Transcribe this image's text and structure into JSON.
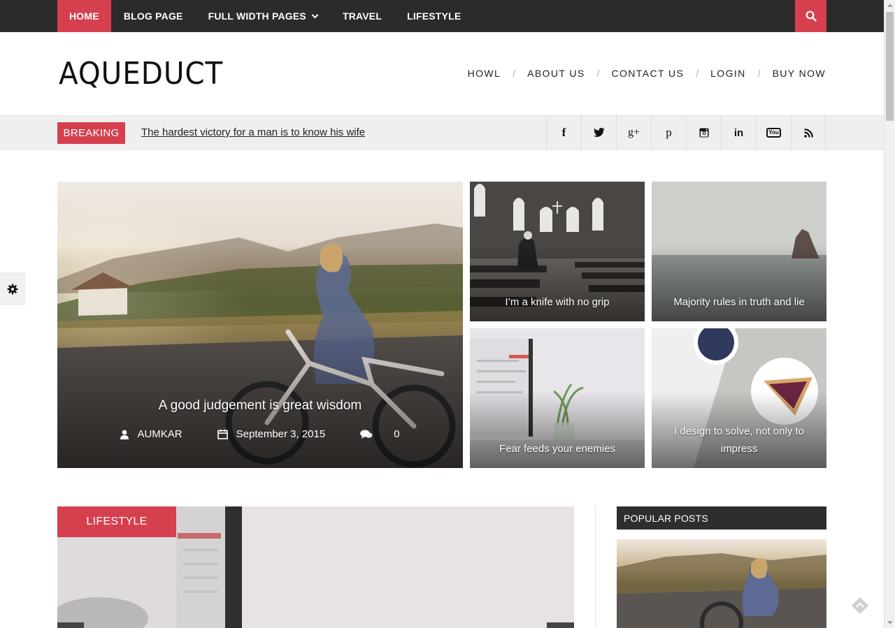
{
  "topnav": {
    "items": [
      {
        "label": "HOME"
      },
      {
        "label": "BLOG PAGE"
      },
      {
        "label": "FULL WIDTH PAGES"
      },
      {
        "label": "TRAVEL"
      },
      {
        "label": "LIFESTYLE"
      }
    ],
    "active_index": 0
  },
  "header": {
    "logo": "AQUEDUCT",
    "nav": [
      {
        "label": "HOWL"
      },
      {
        "label": "ABOUT US"
      },
      {
        "label": "CONTACT US"
      },
      {
        "label": "LOGIN"
      },
      {
        "label": "BUY NOW"
      }
    ],
    "separator": "/"
  },
  "breaking": {
    "label": "BREAKING",
    "headline": "The hardest victory for a man is to know his wife"
  },
  "socials": {
    "icons": [
      "facebook-icon",
      "twitter-icon",
      "google-plus-icon",
      "pinterest-icon",
      "instagram-icon",
      "linkedin-icon",
      "youtube-icon",
      "rss-icon"
    ],
    "glyphs": {
      "facebook": "f",
      "google_plus": "g+",
      "pinterest": "p",
      "linkedin": "in",
      "youtube": "You"
    }
  },
  "featured": {
    "main": {
      "title": "A good judgement is great wisdom",
      "author": "AUMKAR",
      "date": "September 3, 2015",
      "comments": "0"
    },
    "tiles": [
      {
        "title": "I’m a knife with no grip"
      },
      {
        "title": "Majority rules in truth and lie"
      },
      {
        "title": "Fear feeds your enemies"
      },
      {
        "title": "I design to solve, not only to impress"
      }
    ]
  },
  "post": {
    "category": "LIFESTYLE"
  },
  "sidebar": {
    "popular_title": "POPULAR POSTS"
  },
  "colors": {
    "accent": "#d6404e",
    "topbar": "#2b2b2b",
    "breaking_bg": "#efefef"
  }
}
